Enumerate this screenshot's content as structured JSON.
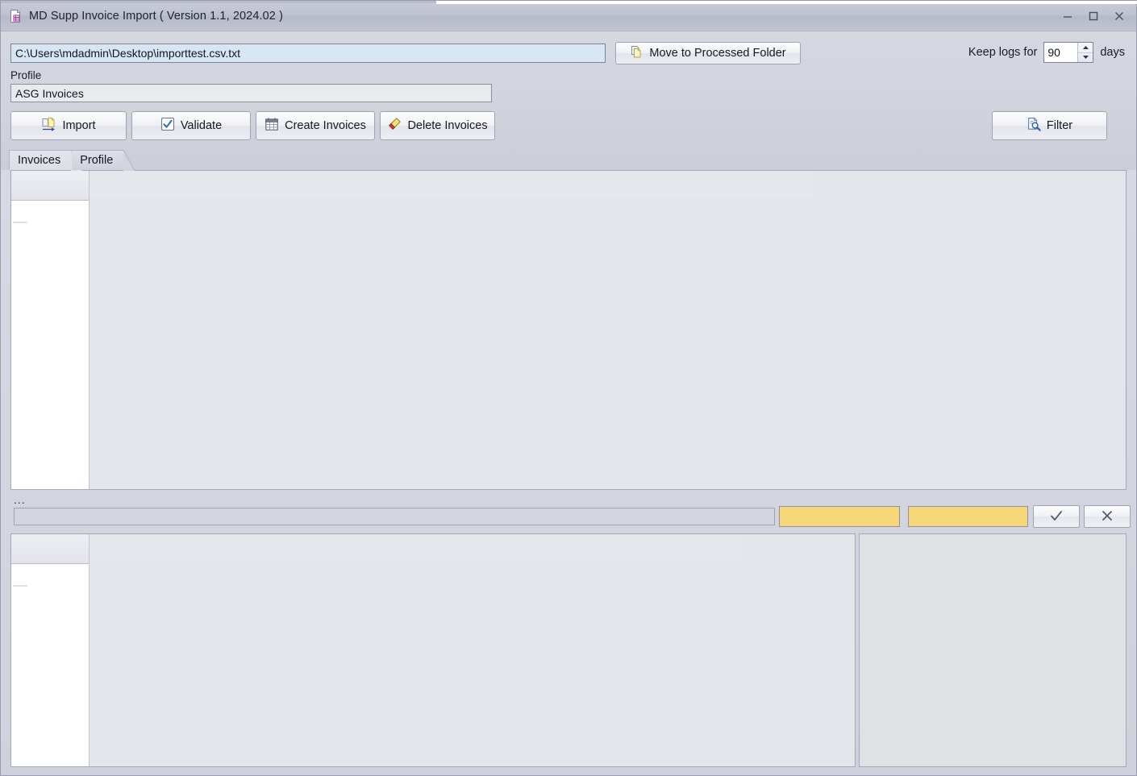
{
  "window": {
    "title": "MD Supp Invoice Import ( Version 1.1, 2024.02 )",
    "icon": "document-grid-icon",
    "controls": {
      "minimize": "minimize-icon",
      "maximize": "maximize-icon",
      "close": "close-icon"
    }
  },
  "toolbar": {
    "path": {
      "value": "C:\\Users\\mdadmin\\Desktop\\importtest.csv.txt",
      "placeholder": "Select import file"
    },
    "move_button": {
      "label": "Move to Processed Folder",
      "icon": "copy-document-icon"
    },
    "keep_logs": {
      "prefix_label": "Keep logs for",
      "value": "90",
      "suffix_label": "days"
    },
    "profile": {
      "label": "Profile",
      "value": "ASG Invoices",
      "placeholder": "Select profile"
    },
    "actions": [
      {
        "label": "Import",
        "icon": "import-document-icon"
      },
      {
        "label": "Validate",
        "icon": "checkbox-checked-icon"
      },
      {
        "label": "Create Invoices",
        "icon": "calendar-grid-icon"
      },
      {
        "label": "Delete Invoices",
        "icon": "eraser-icon"
      }
    ],
    "filter_button": {
      "label": "Filter",
      "icon": "document-search-icon"
    }
  },
  "tabs": [
    {
      "label": "Invoices",
      "active": true
    },
    {
      "label": "Profile",
      "active": false
    }
  ],
  "invoices_grid": {
    "columns": [],
    "rows": []
  },
  "editor_bar": {
    "ellipsis_label": "...",
    "text_field": {
      "value": "",
      "placeholder": ""
    },
    "highlight_field_1": {
      "value": "",
      "placeholder": ""
    },
    "highlight_field_2": {
      "value": "",
      "placeholder": ""
    },
    "accept_button": {
      "label": "✓",
      "icon": "check-icon"
    },
    "cancel_button": {
      "label": "✕",
      "icon": "close-x-icon"
    }
  },
  "detail_grid": {
    "columns": [],
    "rows": []
  },
  "side_panel": {
    "content": ""
  },
  "colors": {
    "window_background": "#d2d3dc",
    "titlebar": "#bfc2d0",
    "path_field_background": "#d6e6f5",
    "highlight_yellow": "#f7d677",
    "grid_background": "#e4e5ea",
    "row_header_background": "#ffffff",
    "border": "#a5a8b8"
  }
}
